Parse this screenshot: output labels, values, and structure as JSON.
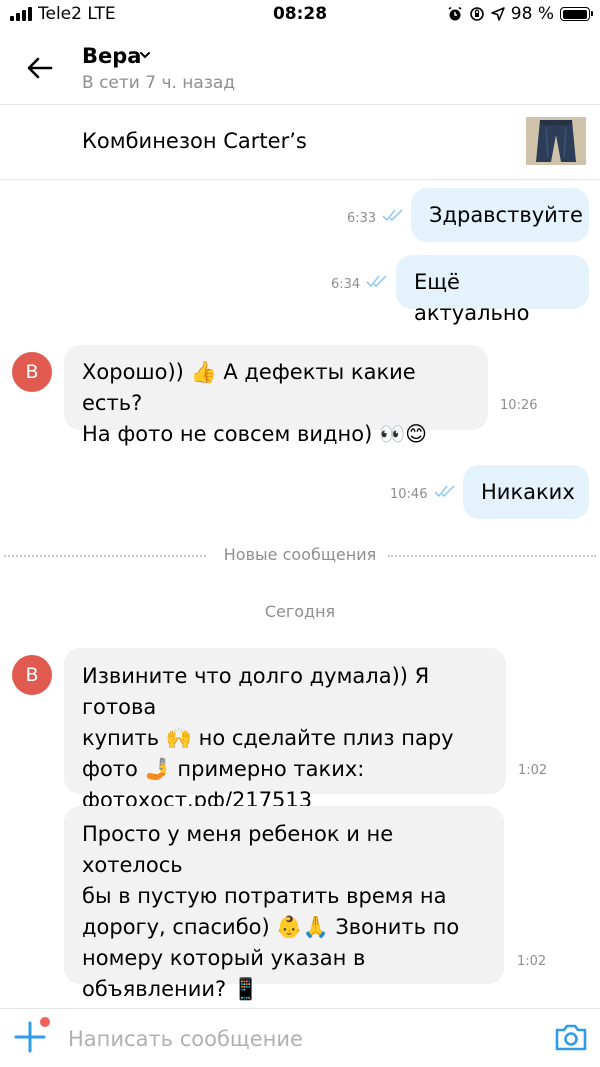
{
  "status_bar": {
    "carrier": "Tele2 LTE",
    "time": "08:28",
    "battery": "98 %",
    "battery_level": 0.98
  },
  "header": {
    "contact_name": "Вера",
    "contact_status": "В сети 7 ч. назад"
  },
  "listing": {
    "title": "Комбинезон Carter’s"
  },
  "messages": [
    {
      "direction": "out",
      "text": "Здравствуйте",
      "time": "6:33"
    },
    {
      "direction": "out",
      "text": "Ещё актуально",
      "time": "6:34"
    },
    {
      "direction": "in",
      "avatar": "В",
      "lines": [
        "Хорошо)) 👍 А дефекты какие есть?",
        "На фото не совсем видно) 👀😊"
      ],
      "time": "10:26"
    },
    {
      "direction": "out",
      "text": "Никаких",
      "time": "10:46"
    },
    {
      "direction": "in",
      "avatar": "В",
      "lines": [
        "Извините что долго думала)) Я готова",
        "купить 🙌 но сделайте плиз пару",
        "фото 🤳 примерно таких:",
        "фотохост.рф/217513"
      ],
      "time": "1:02"
    },
    {
      "direction": "in",
      "lines": [
        "Просто у меня ребенок и не хотелось",
        "бы в пустую потратить время на",
        "дорогу, спасибо) 👶🙏 Звонить по",
        "номеру который указан в",
        "объявлении? 📱"
      ],
      "time": "1:02"
    }
  ],
  "divider": {
    "label": "Новые сообщения"
  },
  "date_separator": "Сегодня",
  "composer": {
    "placeholder": "Написать сообщение"
  },
  "colors": {
    "accent": "#2f9bea",
    "outgoing_bubble": "#e4f2fb",
    "incoming_bubble": "#f2f2f2",
    "avatar": "#e05a4f",
    "badge": "#f0625a"
  },
  "icons": [
    "back-arrow-icon",
    "chevron-down-icon",
    "double-check-icon",
    "plus-icon",
    "camera-icon"
  ]
}
